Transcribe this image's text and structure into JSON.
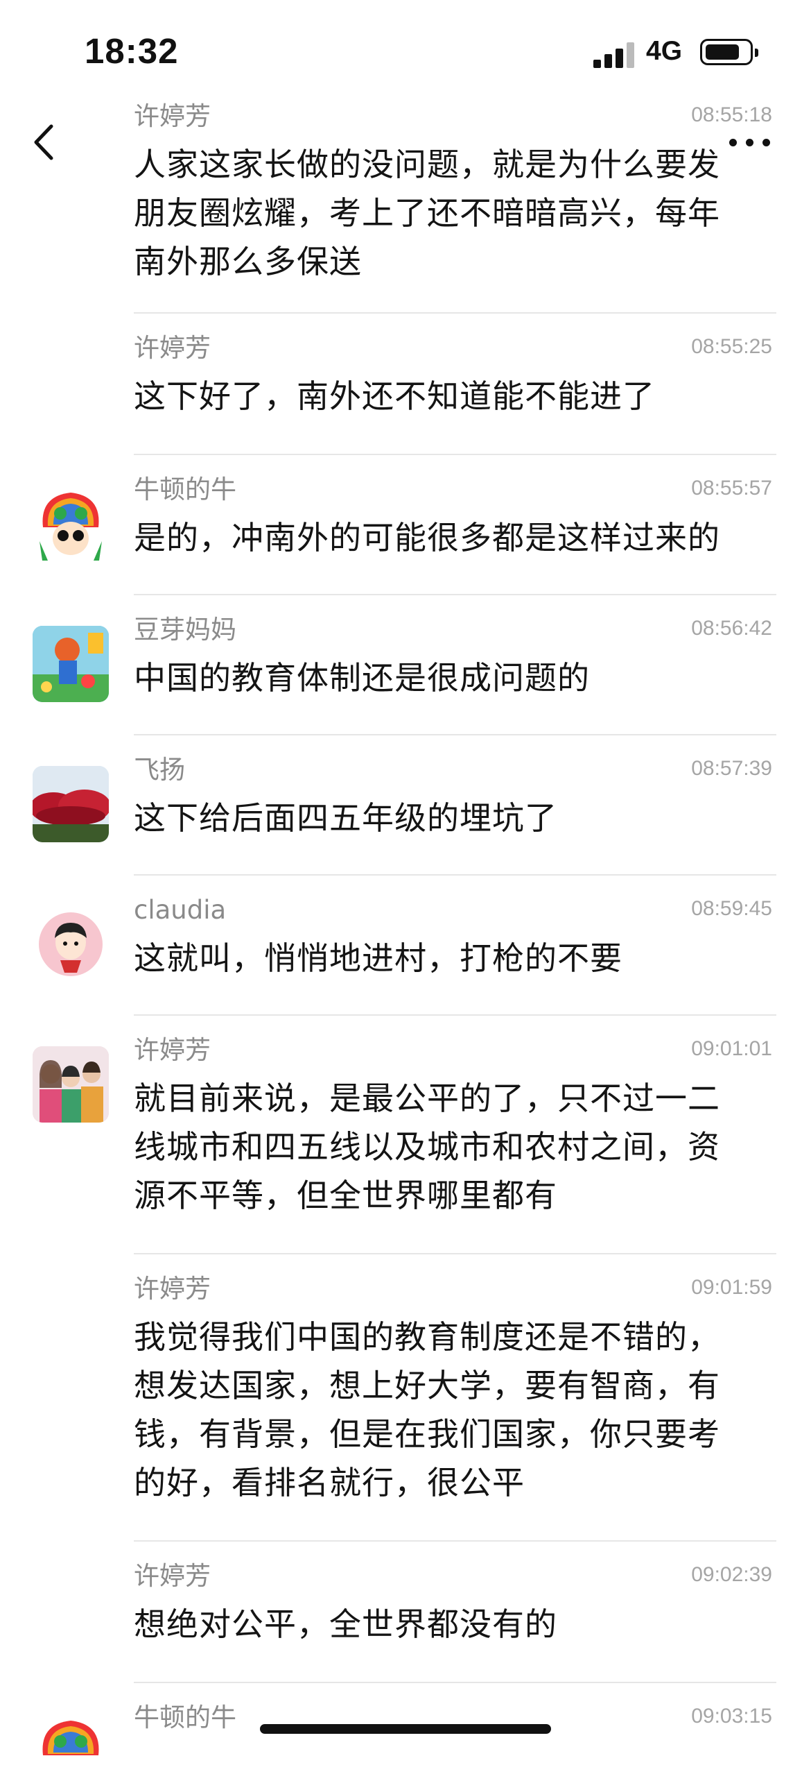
{
  "status_bar": {
    "time": "18:32",
    "network": "4G"
  },
  "colors": {
    "text": "#141414",
    "meta": "#8a8a8a",
    "time": "#a5a5a5",
    "divider": "#e6e6e6"
  },
  "nav": {
    "back_icon": "chevron-left-icon",
    "more_icon": "ellipsis-icon"
  },
  "messages": [
    {
      "sender": "许婷芳",
      "time": "08:55:18",
      "text": "人家这家长做的没问题，就是为什么要发\n朋友圈炫耀，考上了还不暗暗高兴，每年\n南外那么多保送",
      "avatar": "none"
    },
    {
      "sender": "许婷芳",
      "time": "08:55:25",
      "text": "这下好了，南外还不知道能不能进了",
      "avatar": "none"
    },
    {
      "sender": "牛顿的牛",
      "time": "08:55:57",
      "text": "是的，冲南外的可能很多都是这样过来的",
      "avatar": "cartoon-rainbow-hair"
    },
    {
      "sender": "豆芽妈妈",
      "time": "08:56:42",
      "text": "中国的教育体制还是很成问题的",
      "avatar": "cartoon-painting"
    },
    {
      "sender": "飞扬",
      "time": "08:57:39",
      "text": "这下给后面四五年级的埋坑了",
      "avatar": "red-flowering-tree"
    },
    {
      "sender": "claudia",
      "time": "08:59:45",
      "text": "这就叫，悄悄地进村，打枪的不要",
      "avatar": "cartoon-boy-pink"
    },
    {
      "sender": "许婷芳",
      "time": "09:01:01",
      "text": "就目前来说，是最公平的了，只不过一二\n线城市和四五线以及城市和农村之间，资\n源不平等，但全世界哪里都有",
      "avatar": "family-photo"
    },
    {
      "sender": "许婷芳",
      "time": "09:01:59",
      "text": "我觉得我们中国的教育制度还是不错的，\n想发达国家，想上好大学，要有智商，有\n钱，有背景，但是在我们国家，你只要考\n的好，看排名就行，很公平",
      "avatar": "none"
    },
    {
      "sender": "许婷芳",
      "time": "09:02:39",
      "text": "想绝对公平，全世界都没有的",
      "avatar": "none"
    },
    {
      "sender": "牛顿的牛",
      "time": "09:03:15",
      "text": "",
      "avatar": "cartoon-rainbow-hair"
    }
  ]
}
